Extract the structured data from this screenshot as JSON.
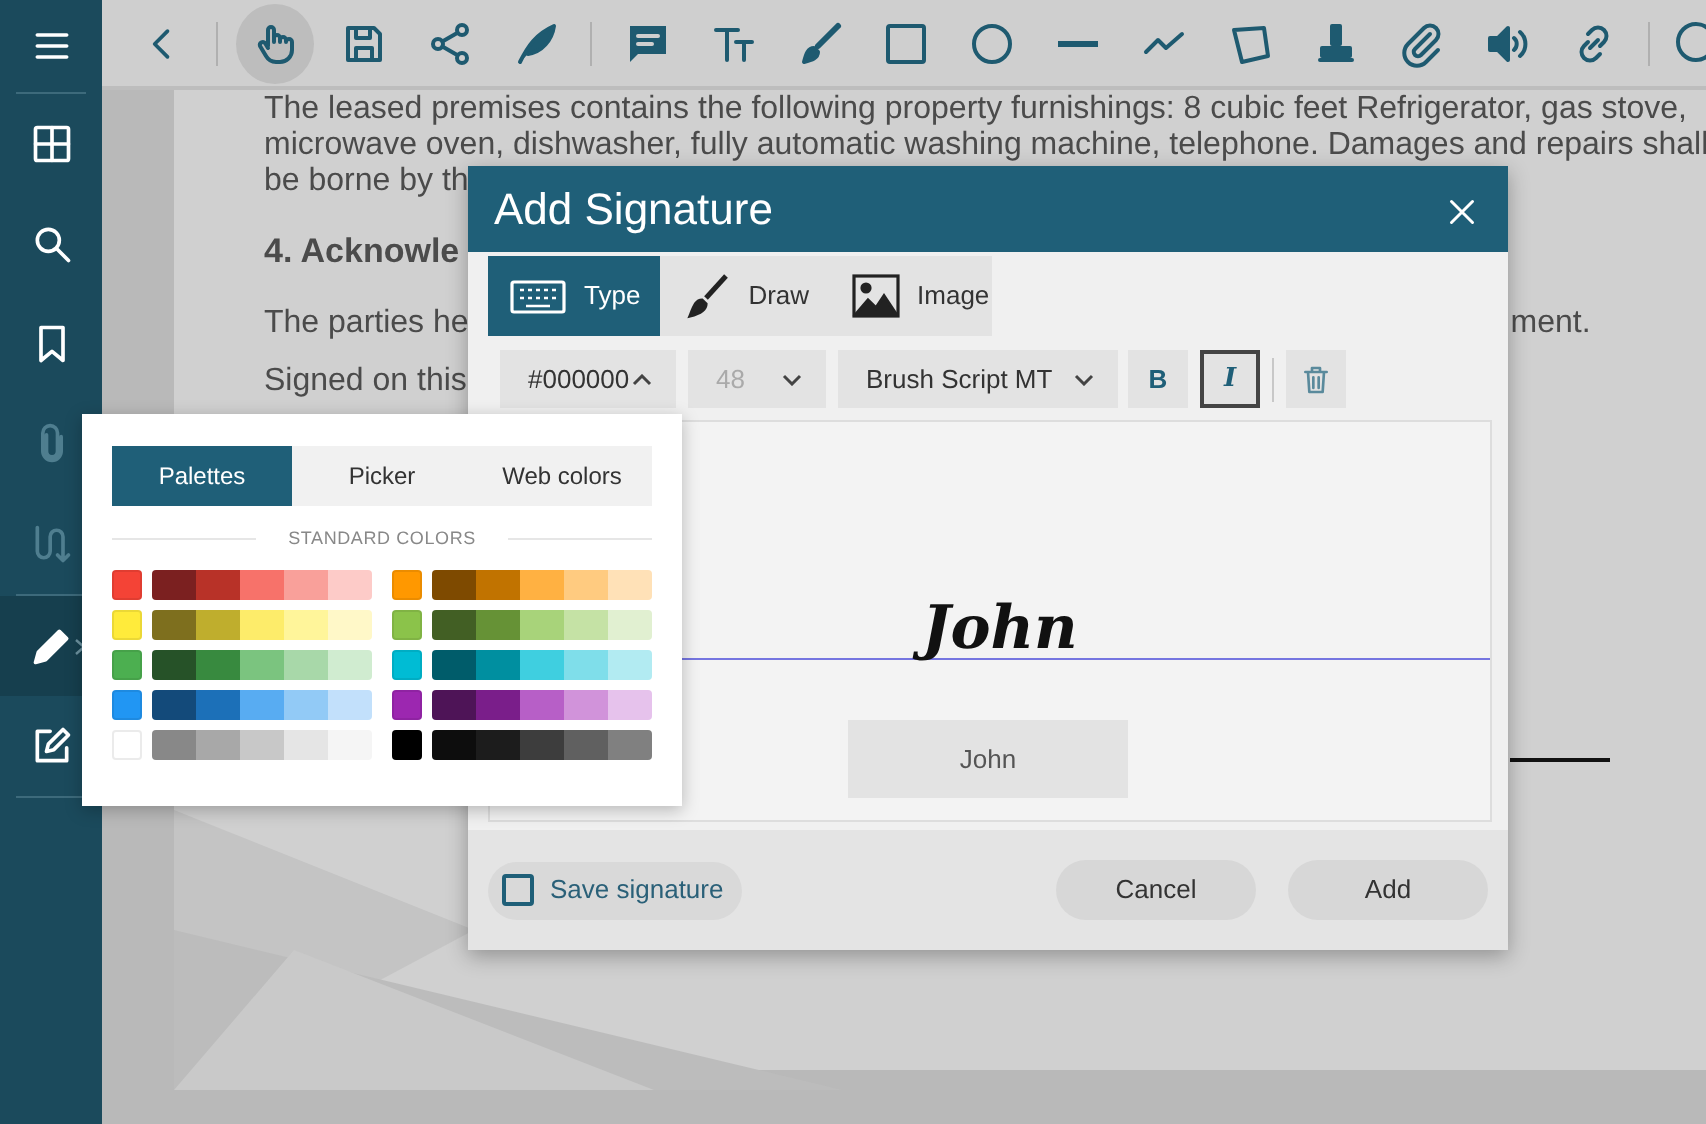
{
  "sidebar": {
    "items": [
      {
        "selected": false,
        "disabled": false
      },
      {
        "selected": false,
        "disabled": false
      },
      {
        "selected": false,
        "disabled": false
      },
      {
        "selected": false,
        "disabled": true
      },
      {
        "selected": false,
        "disabled": true
      },
      {
        "selected": true,
        "disabled": false
      },
      {
        "selected": false,
        "disabled": false
      }
    ]
  },
  "toolbar": {
    "tools": [
      {
        "selected": false
      },
      {
        "selected": true
      },
      {
        "selected": false
      },
      {
        "selected": false
      },
      {
        "selected": false
      },
      {
        "selected": false
      },
      {
        "selected": false
      },
      {
        "selected": false
      },
      {
        "selected": false
      },
      {
        "selected": false
      },
      {
        "selected": false
      },
      {
        "selected": false
      },
      {
        "selected": false
      },
      {
        "selected": false
      },
      {
        "selected": false
      },
      {
        "selected": false
      },
      {
        "selected": false
      }
    ]
  },
  "document": {
    "lines": [
      "The leased premises contains the following property furnishings: 8 cubic feet Refrigerator, gas stove,",
      "microwave oven, dishwasher, fully automatic washing machine, telephone. Damages and repairs shall",
      "be borne by th"
    ],
    "heading": "4. Acknowle",
    "paragraph_left": "The parties he",
    "paragraph_right": "ment.",
    "signed_line": "Signed on this"
  },
  "dialog": {
    "title": "Add Signature",
    "tabs": [
      {
        "label": "Type",
        "selected": true
      },
      {
        "label": "Draw",
        "selected": false
      },
      {
        "label": "Image",
        "selected": false
      }
    ],
    "color_field": {
      "value": "#000000",
      "expanded": true
    },
    "size_field": {
      "value": "48",
      "disabled": true
    },
    "font_field": {
      "value": "Brush Script MT"
    },
    "bold_button": {
      "label": "B",
      "active": false
    },
    "italic_button": {
      "label": "I",
      "active": true
    },
    "preview_text": "John",
    "name_input": {
      "value": "John"
    },
    "save_signature": {
      "label": "Save signature",
      "checked": false
    },
    "buttons": [
      "Cancel",
      "Add"
    ]
  },
  "color_picker": {
    "tabs": [
      {
        "label": "Palettes",
        "selected": true
      },
      {
        "label": "Picker",
        "selected": false
      },
      {
        "label": "Web colors",
        "selected": false
      }
    ],
    "heading": "STANDARD COLORS",
    "groups": [
      {
        "rows": [
          {
            "color": "#f44336",
            "shades": [
              {
                "color": "#7b2020"
              },
              {
                "color": "#b83228"
              },
              {
                "color": "#f7726a"
              },
              {
                "color": "#f9a09a"
              },
              {
                "color": "#fdcbc8"
              }
            ]
          },
          {
            "color": "#ffeb3b",
            "shades": [
              {
                "color": "#7e6f1e"
              },
              {
                "color": "#bfae2d"
              },
              {
                "color": "#fdec6a"
              },
              {
                "color": "#fff59a"
              },
              {
                "color": "#fff8c8"
              }
            ]
          },
          {
            "color": "#4caf50",
            "shades": [
              {
                "color": "#265228"
              },
              {
                "color": "#388a3f"
              },
              {
                "color": "#7bc47f"
              },
              {
                "color": "#a8d8a9"
              },
              {
                "color": "#d0ecd0"
              }
            ]
          },
          {
            "color": "#2196f3",
            "shades": [
              {
                "color": "#134a7a"
              },
              {
                "color": "#1c70b8"
              },
              {
                "color": "#58acf2"
              },
              {
                "color": "#92caf6"
              },
              {
                "color": "#c2e0fb"
              }
            ]
          },
          {
            "color": "#ffffff",
            "shades": [
              {
                "color": "#888888"
              },
              {
                "color": "#a8a8a8"
              },
              {
                "color": "#c8c8c8"
              },
              {
                "color": "#e5e5e5"
              },
              {
                "color": "#f5f5f5"
              }
            ]
          }
        ]
      },
      {
        "rows": [
          {
            "color": "#ff9800",
            "shades": [
              {
                "color": "#7e4a00"
              },
              {
                "color": "#c17300"
              },
              {
                "color": "#ffb142"
              },
              {
                "color": "#ffcb80"
              },
              {
                "color": "#ffe1b7"
              }
            ]
          },
          {
            "color": "#8bc34a",
            "shades": [
              {
                "color": "#425f24"
              },
              {
                "color": "#669236"
              },
              {
                "color": "#a8d37a"
              },
              {
                "color": "#c5e2a5"
              },
              {
                "color": "#e1f0d1"
              }
            ]
          },
          {
            "color": "#00bcd4",
            "shades": [
              {
                "color": "#005c6a"
              },
              {
                "color": "#008fa0"
              },
              {
                "color": "#3fcfe0"
              },
              {
                "color": "#7fdeea"
              },
              {
                "color": "#b2ebf2"
              }
            ]
          },
          {
            "color": "#9c27b0",
            "shades": [
              {
                "color": "#4e1457"
              },
              {
                "color": "#7a1e8a"
              },
              {
                "color": "#b75fc7"
              },
              {
                "color": "#d193da"
              },
              {
                "color": "#e6c2ec"
              }
            ]
          },
          {
            "color": "#000000",
            "shades": [
              {
                "color": "#0d0d0d"
              },
              {
                "color": "#1c1c1c"
              },
              {
                "color": "#3d3d3d"
              },
              {
                "color": "#606060"
              },
              {
                "color": "#808080"
              }
            ]
          }
        ]
      }
    ]
  }
}
